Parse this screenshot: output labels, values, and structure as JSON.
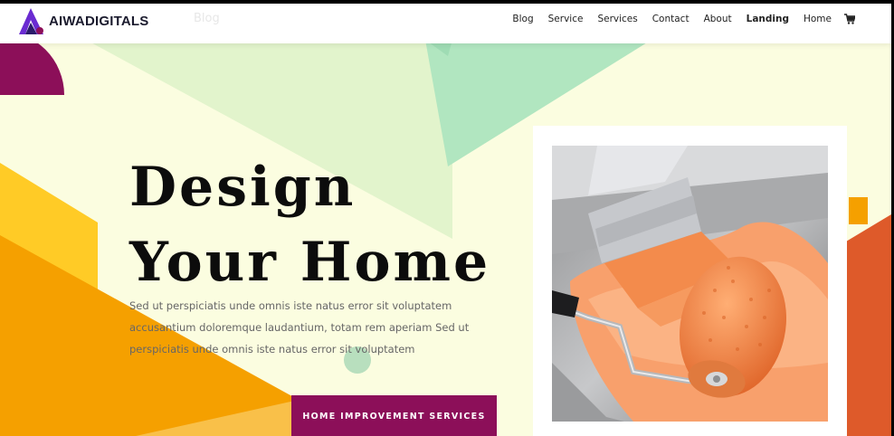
{
  "brand": {
    "name": "AIWADIGITALS",
    "ghost_nav_text": "Blog"
  },
  "nav": {
    "items": [
      {
        "label": "Blog",
        "bold": false
      },
      {
        "label": "Service",
        "bold": false
      },
      {
        "label": "Services",
        "bold": false
      },
      {
        "label": "Contact",
        "bold": false
      },
      {
        "label": "About",
        "bold": false
      },
      {
        "label": "Landing",
        "bold": true
      },
      {
        "label": "Home",
        "bold": false
      }
    ],
    "cart_icon": "cart-icon"
  },
  "hero": {
    "title_line1": "Design",
    "title_line2": "Your Home",
    "description": "Sed ut perspiciatis unde omnis iste natus error sit voluptatem accusantium doloremque laudantium, totam rem aperiam Sed ut perspiciatis unde omnis iste natus error sit voluptatem",
    "cta_label": "HOME IMPROVEMENT SERVICES"
  },
  "image": {
    "subject": "paint-roller-and-brush-photo"
  },
  "colors": {
    "page_background": "#fbfde0",
    "brand_purple": "#8c0f59",
    "logo_purple": "#6a2bd1",
    "accent_orange": "#f5a000",
    "accent_yellow": "#ffcb26",
    "accent_green": "#b1e6c0",
    "accent_red_orange": "#de5a2a",
    "roller_orange": "#f47d3c"
  }
}
